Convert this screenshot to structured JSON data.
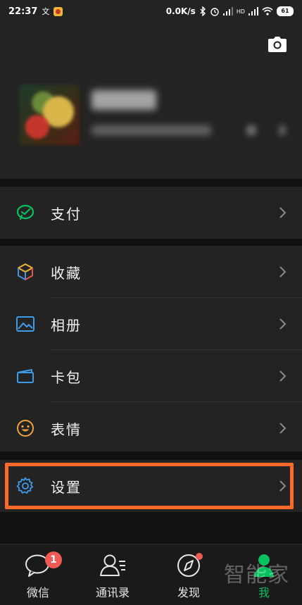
{
  "status": {
    "time": "22:37",
    "network_speed": "0.0K/s",
    "signal_type": "HD",
    "battery": "61"
  },
  "menu": {
    "pay": "支付",
    "favorites": "收藏",
    "album": "相册",
    "cards": "卡包",
    "stickers": "表情",
    "settings": "设置"
  },
  "tabs": {
    "chats": "微信",
    "chats_badge": "1",
    "contacts": "通讯录",
    "discover": "发现",
    "me": "我"
  },
  "watermark": "智能家",
  "colors": {
    "accent_green": "#07c160",
    "highlight_orange": "#ff6a2a",
    "badge_red": "#f05a55"
  }
}
